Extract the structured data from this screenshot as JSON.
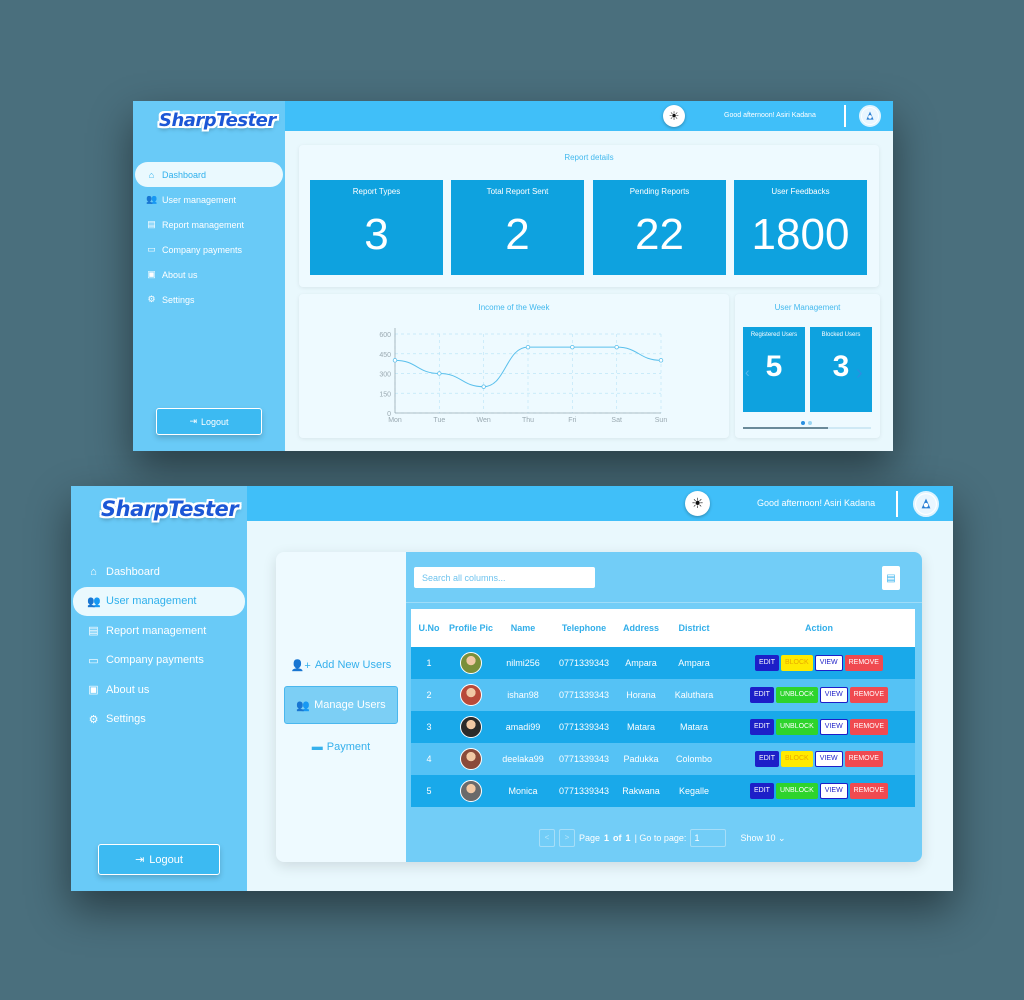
{
  "app": {
    "brand": "SharpTester",
    "greeting": "Good afternoon! Asiri Kadana",
    "logout_label": "Logout"
  },
  "nav": [
    {
      "label": "Dashboard",
      "icon": "home-icon"
    },
    {
      "label": "User management",
      "icon": "users-icon"
    },
    {
      "label": "Report management",
      "icon": "file-icon"
    },
    {
      "label": "Company payments",
      "icon": "credit-card-icon"
    },
    {
      "label": "About us",
      "icon": "id-card-icon"
    },
    {
      "label": "Settings",
      "icon": "gear-icon"
    }
  ],
  "dashboard": {
    "report_title": "Report details",
    "stats": [
      {
        "label": "Report Types",
        "value": "3"
      },
      {
        "label": "Total Report Sent",
        "value": "2"
      },
      {
        "label": "Pending Reports",
        "value": "22"
      },
      {
        "label": "User Feedbacks",
        "value": "1800"
      }
    ],
    "income_title": "Income of the Week",
    "user_mgmt_title": "User Management",
    "user_stats": [
      {
        "label": "Registered Users",
        "value": "5"
      },
      {
        "label": "Blocked Users",
        "value": "3"
      }
    ]
  },
  "chart_data": {
    "type": "line",
    "title": "Income of the Week",
    "categories": [
      "Mon",
      "Tue",
      "Wen",
      "Thu",
      "Fri",
      "Sat",
      "Sun"
    ],
    "values": [
      400,
      300,
      200,
      500,
      500,
      500,
      400
    ],
    "yticks": [
      0,
      150,
      300,
      450,
      600
    ],
    "ylim": [
      0,
      600
    ],
    "grid": true,
    "color": "#5bc0ec"
  },
  "users_page": {
    "subnav": [
      {
        "label": "Add New Users",
        "icon": "user-plus-icon"
      },
      {
        "label": "Manage Users",
        "icon": "users-cog-icon"
      },
      {
        "label": "Payment",
        "icon": "payment-card-icon"
      }
    ],
    "search_placeholder": "Search all columns...",
    "columns": [
      "U.No",
      "Profile Pic",
      "Name",
      "Telephone",
      "Address",
      "District",
      "Action"
    ],
    "rows": [
      {
        "no": "1",
        "name": "nilmi256",
        "tel": "0771339343",
        "address": "Ampara",
        "district": "Ampara",
        "status_action": "BLOCK",
        "avatar_color": "#7a8f3a"
      },
      {
        "no": "2",
        "name": "ishan98",
        "tel": "0771339343",
        "address": "Horana",
        "district": "Kaluthara",
        "status_action": "UNBLOCK",
        "avatar_color": "#b84a3a"
      },
      {
        "no": "3",
        "name": "amadi99",
        "tel": "0771339343",
        "address": "Matara",
        "district": "Matara",
        "status_action": "UNBLOCK",
        "avatar_color": "#2b2b2b"
      },
      {
        "no": "4",
        "name": "deelaka99",
        "tel": "0771339343",
        "address": "Padukka",
        "district": "Colombo",
        "status_action": "BLOCK",
        "avatar_color": "#8a4a3a"
      },
      {
        "no": "5",
        "name": "Monica",
        "tel": "0771339343",
        "address": "Rakwana",
        "district": "Kegalle",
        "status_action": "UNBLOCK",
        "avatar_color": "#6a6a6a"
      }
    ],
    "actions": {
      "edit": "EDIT",
      "view": "VIEW",
      "remove": "REMOVE"
    },
    "pager": {
      "prev": "<",
      "next": ">",
      "page_word": "Page",
      "current": "1",
      "of_word": "of",
      "total": "1",
      "goto_label": "| Go to page:",
      "goto_value": "1",
      "show_label": "Show 10"
    }
  }
}
